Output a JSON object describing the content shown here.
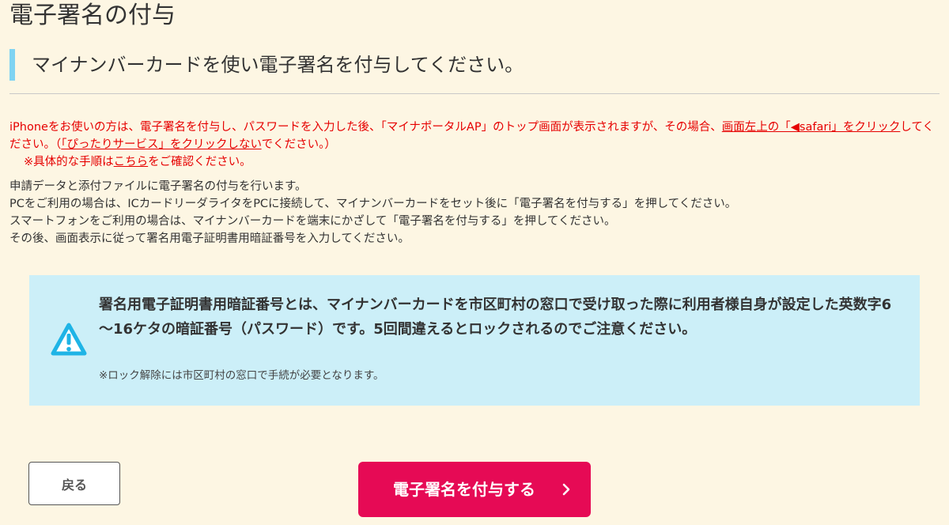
{
  "page": {
    "title": "電子署名の付与",
    "heading": "マイナンバーカードを使い電子署名を付与してください。"
  },
  "notice": {
    "part1": "iPhoneをお使いの方は、電子署名を付与し、パスワードを入力した後、「マイナポータルAP」のトップ画面が表示されますが、その場合、",
    "link1": "画面左上の「◀safari」をクリック",
    "part2": "してください。（",
    "link2": "「ぴったりサービス」をクリックしない",
    "part3": "でください。）",
    "line2_prefix": "※具体的な手順は",
    "line2_link": "こちら",
    "line2_suffix": "をご確認ください。"
  },
  "description": [
    "申請データと添付ファイルに電子署名の付与を行います。",
    "PCをご利用の場合は、ICカードリーダライタをPCに接続して、マイナンバーカードをセット後に「電子署名を付与する」を押してください。",
    "スマートフォンをご利用の場合は、マイナンバーカードを端末にかざして「電子署名を付与する」を押してください。",
    "その後、画面表示に従って署名用電子証明書用暗証番号を入力してください。"
  ],
  "info": {
    "icon": "warning-icon",
    "strong": "署名用電子証明書用暗証番号とは、マイナンバーカードを市区町村の窓口で受け取った際に利用者様自身が設定した英数字6～16ケタの暗証番号（パスワード）です。5回間違えるとロックされるのでご注意ください。",
    "note": "※ロック解除には市区町村の窓口で手続が必要となります。"
  },
  "buttons": {
    "back": "戻る",
    "sign": "電子署名を付与する",
    "sign_icon": "chevron-right-icon"
  },
  "colors": {
    "background": "#fdf6e3",
    "accent_bar": "#7fd3f2",
    "notice_red": "#e60000",
    "info_bg": "#cceff8",
    "warning_icon": "#1fb4e6",
    "primary_button": "#e60a55"
  }
}
